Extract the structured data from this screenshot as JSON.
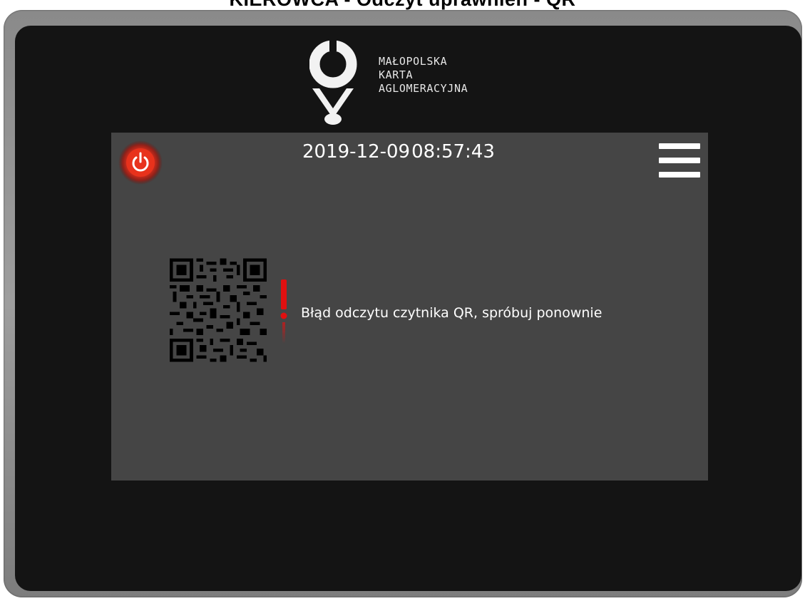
{
  "page": {
    "title": "KIEROWCA - Odczyt uprawnień - QR"
  },
  "logo": {
    "lines": [
      "MAŁOPOLSKA",
      "KARTA",
      "AGLOMERACYJNA"
    ]
  },
  "status_bar": {
    "date": "2019-12-09",
    "time": "08:57:43"
  },
  "message": {
    "text": "Błąd odczytu czytnika QR, spróbuj ponownie"
  },
  "icons": {
    "power": "power-icon",
    "menu": "hamburger-menu-icon",
    "qr": "qr-code-icon",
    "warning": "exclamation-icon"
  },
  "colors": {
    "screen_bg": "#454545",
    "bezel": "#141414",
    "power_red": "#e4321f",
    "warning_red": "#e01010",
    "text": "#ffffff"
  }
}
